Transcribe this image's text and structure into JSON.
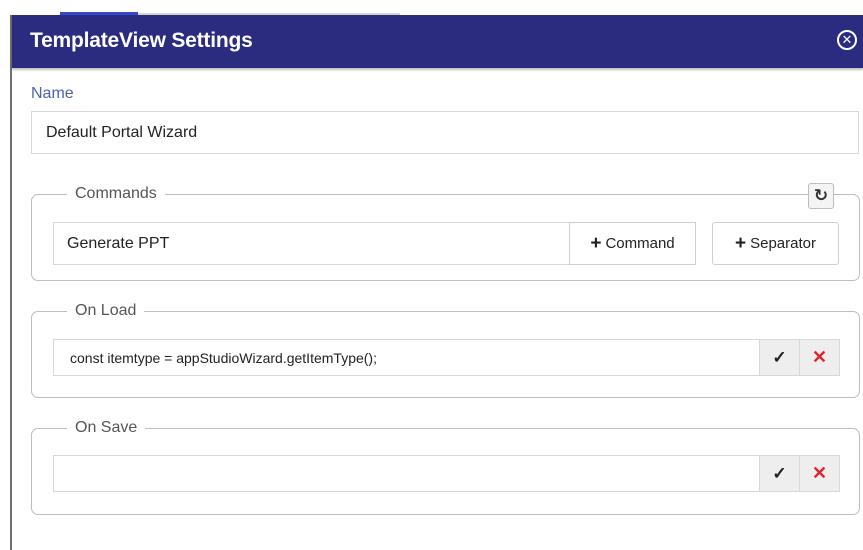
{
  "dialog": {
    "title": "TemplateView Settings",
    "close_icon": "circle-x-icon"
  },
  "name": {
    "label": "Name",
    "value": "Default Portal Wizard"
  },
  "commands": {
    "legend": "Commands",
    "refresh_icon": "refresh-icon",
    "items": [
      "Generate PPT"
    ],
    "add_command_label": "Command",
    "add_separator_label": "Separator"
  },
  "on_load": {
    "legend": "On Load",
    "value": "const itemtype = appStudioWizard.getItemType();"
  },
  "on_save": {
    "legend": "On Save",
    "value": ""
  },
  "colors": {
    "titlebar": "#2b2b80",
    "accent": "#3548c9",
    "label": "#4a64a8",
    "cancel": "#e0242b"
  }
}
